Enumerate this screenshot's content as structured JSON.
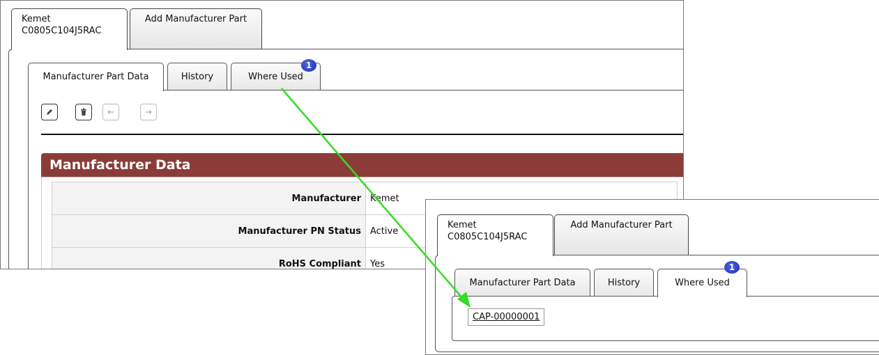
{
  "outer_tabs": {
    "part_tab_line1": "Kemet",
    "part_tab_line2": "C0805C104J5RAC",
    "add_tab": "Add Manufacturer Part"
  },
  "inner_tabs": {
    "part_data": "Manufacturer Part Data",
    "history": "History",
    "where_used": "Where Used",
    "where_used_badge": "1"
  },
  "toolbar": {
    "icons": [
      "pencil-icon",
      "trash-icon",
      "arrow-left-icon",
      "arrow-right-icon"
    ]
  },
  "section": {
    "title": "Manufacturer Data",
    "header_color": "#8b3c38"
  },
  "fields": [
    {
      "label": "Manufacturer",
      "value": "Kemet"
    },
    {
      "label": "Manufacturer PN Status",
      "value": "Active"
    },
    {
      "label": "RoHS Compliant",
      "value": "Yes"
    }
  ],
  "where_used_link": "CAP-00000001",
  "annotation": {
    "arrow_color": "#33dd22"
  }
}
